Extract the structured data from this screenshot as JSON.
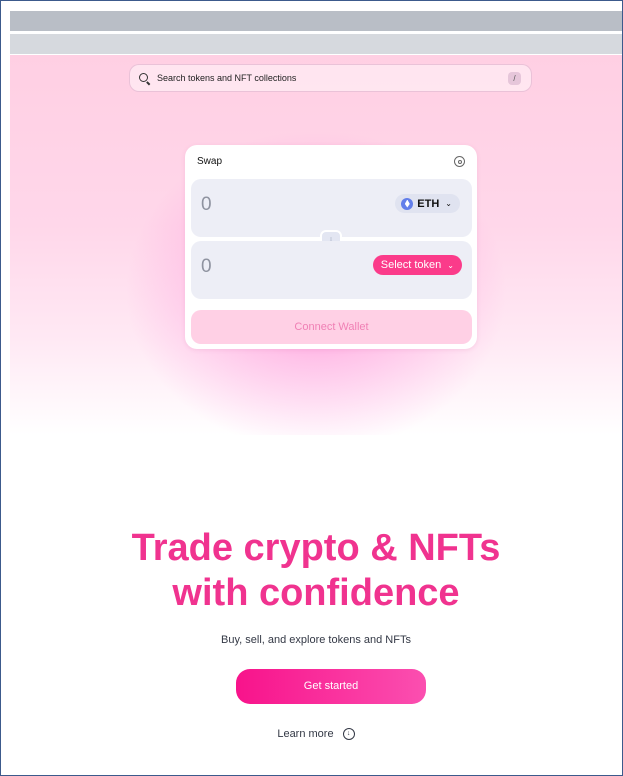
{
  "search": {
    "placeholder": "Search tokens and NFT collections",
    "shortcut": "/"
  },
  "swap": {
    "title": "Swap",
    "from": {
      "amount": "0",
      "token": "ETH",
      "token_icon": "ethereum-icon"
    },
    "to": {
      "amount": "0",
      "select_label": "Select token"
    },
    "connect_label": "Connect Wallet"
  },
  "hero": {
    "headline_line1": "Trade crypto & NFTs",
    "headline_line2": "with confidence",
    "subtitle": "Buy, sell, and explore tokens and NFTs",
    "cta_label": "Get started",
    "learn_more_label": "Learn more"
  },
  "colors": {
    "accent": "#fb3b8a",
    "headline": "#f0338f",
    "eth": "#627eea"
  }
}
